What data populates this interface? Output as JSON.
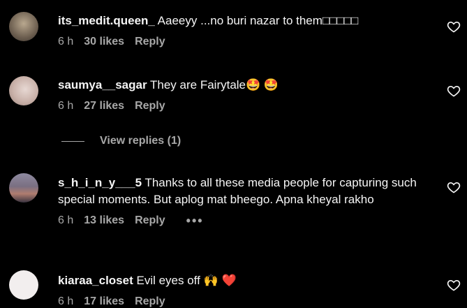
{
  "comments": [
    {
      "username": "its_medit.queen_",
      "text": "Aaeeyy ...no buri nazar to them□□□□□",
      "time": "6 h",
      "likes": "30 likes",
      "reply": "Reply",
      "avatar_color": "#8a7a6a"
    },
    {
      "username": "saumya__sagar",
      "text": "They are Fairytale🤩 🤩",
      "time": "6 h",
      "likes": "27 likes",
      "reply": "Reply",
      "avatar_color": "#d9c6c0"
    },
    {
      "username": "s_h_i_n_y___5",
      "text": "Thanks to all these media people for capturing such special moments. But aplog mat bheego. Apna kheyal rakho",
      "time": "6 h",
      "likes": "13 likes",
      "reply": "Reply",
      "more": "•••",
      "avatar_color": "#6e6a78"
    },
    {
      "username": "kiaraa_closet",
      "text": "Evil eyes off 🙌 ❤️",
      "time": "6 h",
      "likes": "17 likes",
      "reply": "Reply",
      "avatar_color": "#f2eeee"
    }
  ],
  "view_replies": "View replies (1)",
  "icons": {
    "like": "heart-outline-icon",
    "more": "more-options-icon"
  }
}
